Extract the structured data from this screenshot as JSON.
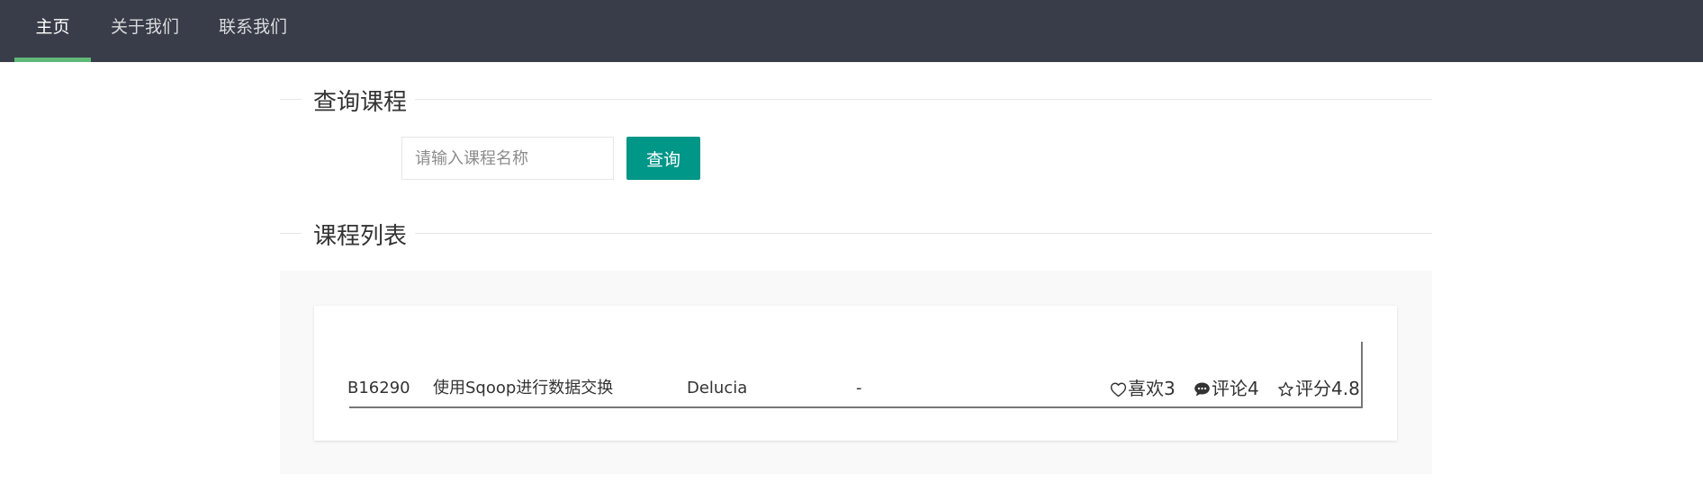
{
  "nav": {
    "items": [
      {
        "label": "主页",
        "active": true
      },
      {
        "label": "关于我们",
        "active": false
      },
      {
        "label": "联系我们",
        "active": false
      }
    ]
  },
  "search_section": {
    "title": "查询课程",
    "input_placeholder": "请输入课程名称",
    "input_value": "",
    "button_label": "查询"
  },
  "list_section": {
    "title": "课程列表"
  },
  "courses": [
    {
      "id": "B16290",
      "name": "使用Sqoop进行数据交换",
      "teacher": "Delucia",
      "extra": "-",
      "likes_label": "喜欢3",
      "comments_label": "评论4",
      "rating_label": "评分4.8"
    }
  ],
  "colors": {
    "navbar_bg": "#393d49",
    "nav_active_underline": "#5fb878",
    "primary_button": "#009688",
    "panel_bg": "#f9f9f9"
  },
  "icons": {
    "like": "heart-outline-icon",
    "comment": "speech-bubble-icon",
    "rating": "star-outline-icon"
  }
}
